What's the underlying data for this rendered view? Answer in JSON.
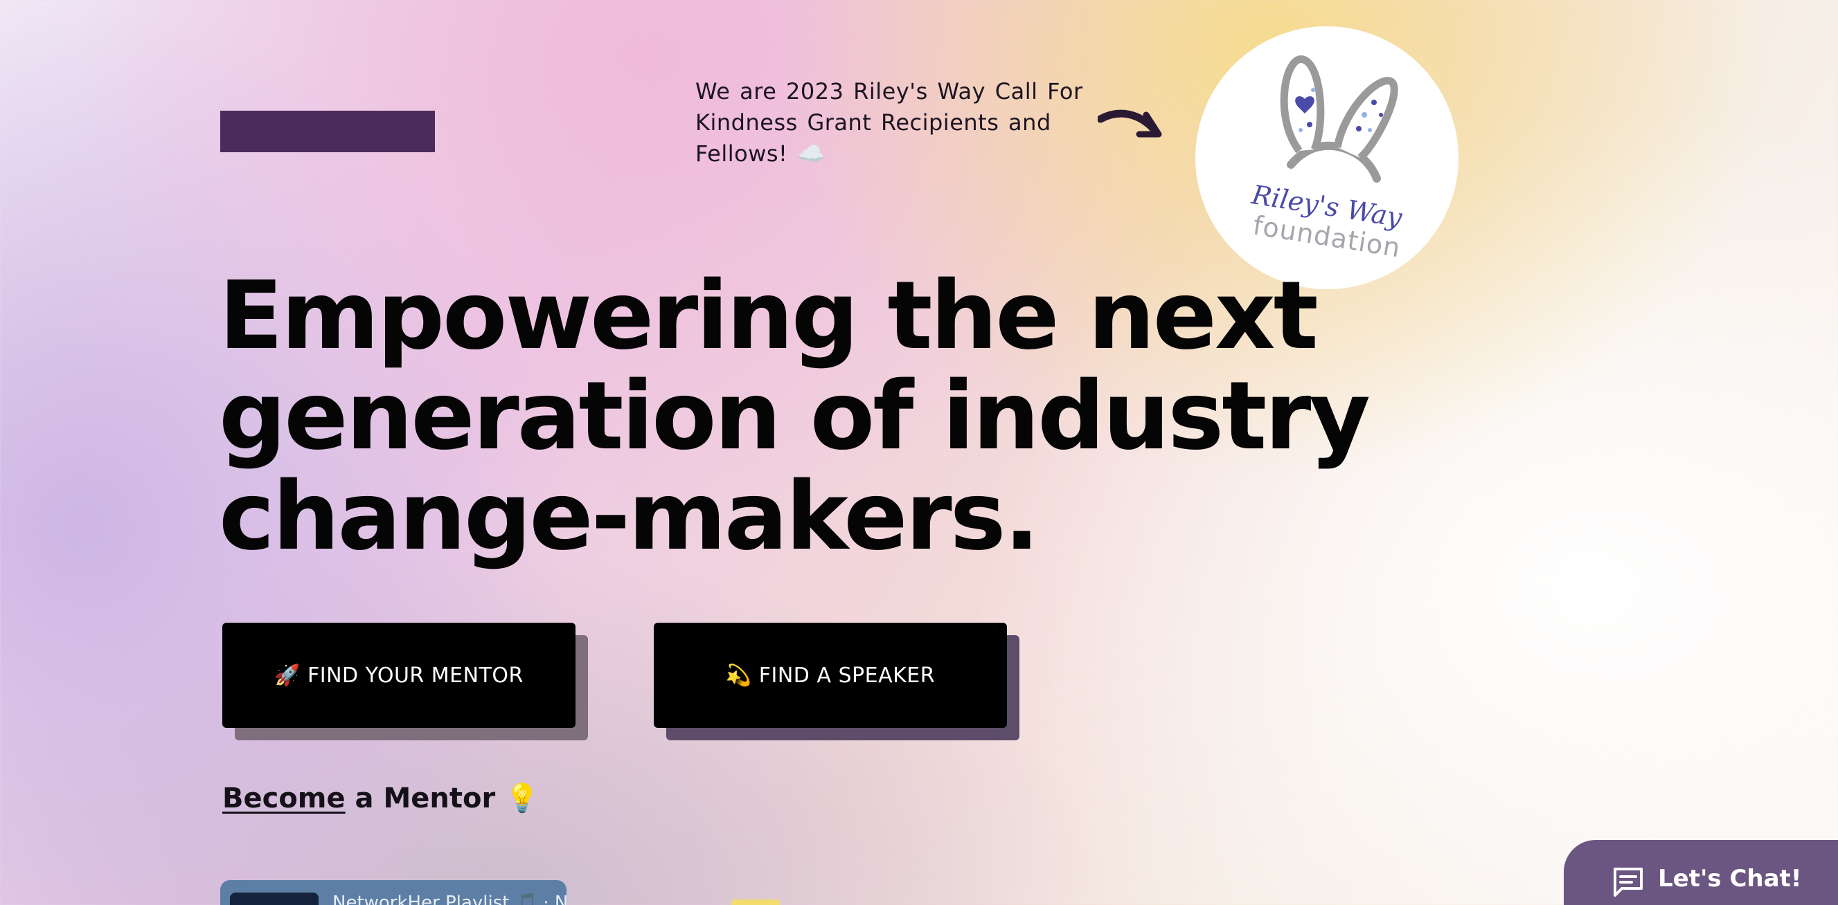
{
  "header": {
    "announcement": "We are 2023 Riley's Way Call For Kindness Grant Recipients and Fellows! ☁️",
    "badge": {
      "line1": "Riley's Way",
      "line2": "foundation"
    }
  },
  "hero": {
    "headline_lines": [
      "Empowering the next",
      "generation of industry",
      "change-makers."
    ]
  },
  "actions": {
    "mentor_emoji": "🚀",
    "mentor_label": "FIND YOUR MENTOR",
    "speaker_emoji": "💫",
    "speaker_label": "FIND A SPEAKER"
  },
  "become_mentor": {
    "link": "Become",
    "rest": " a Mentor",
    "emoji": "💡"
  },
  "playlist": {
    "title": "NetworkHer Playlist 🎵 · Ne"
  },
  "chat": {
    "label": "Let's Chat!"
  },
  "colors": {
    "logo_bar": "#4c2a5d",
    "button_bg": "#000000",
    "chat_bg": "#6a5680",
    "badge_text": "#4a4aa8"
  },
  "icons": [
    "arrow-icon",
    "bunny-ears-icon",
    "chat-icon"
  ]
}
